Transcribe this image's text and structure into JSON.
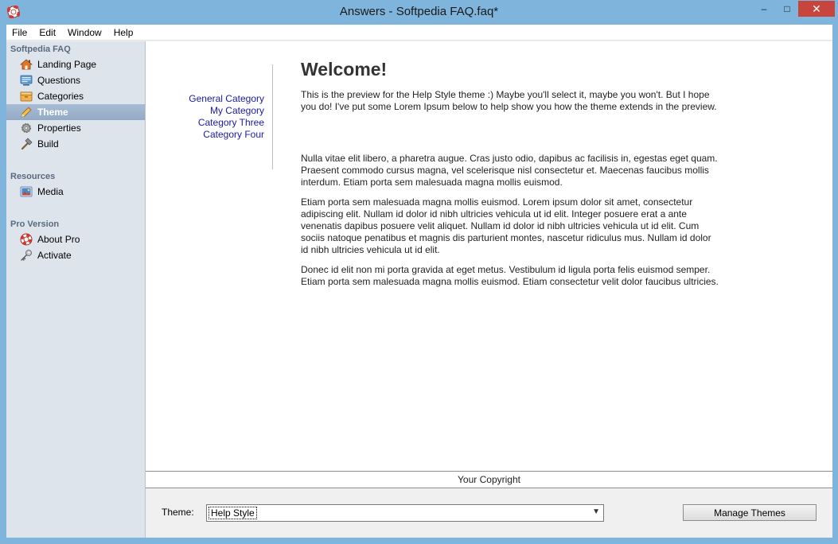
{
  "window": {
    "title": "Answers - Softpedia FAQ.faq*",
    "minimize": "–",
    "maximize": "□",
    "close": "✕"
  },
  "menu": [
    "File",
    "Edit",
    "Window",
    "Help"
  ],
  "sidebar": {
    "sections": [
      {
        "title": "Softpedia FAQ",
        "items": [
          {
            "label": "Landing Page",
            "icon": "house-icon"
          },
          {
            "label": "Questions",
            "icon": "questions-icon"
          },
          {
            "label": "Categories",
            "icon": "categories-icon"
          },
          {
            "label": "Theme",
            "icon": "pencil-icon",
            "selected": true
          },
          {
            "label": "Properties",
            "icon": "gear-icon"
          },
          {
            "label": "Build",
            "icon": "hammer-icon"
          }
        ]
      },
      {
        "title": "Resources",
        "items": [
          {
            "label": "Media",
            "icon": "media-icon"
          }
        ]
      },
      {
        "title": "Pro Version",
        "items": [
          {
            "label": "About Pro",
            "icon": "lifebuoy-icon"
          },
          {
            "label": "Activate",
            "icon": "key-icon"
          }
        ]
      }
    ]
  },
  "preview": {
    "categories": [
      "General Category",
      "My Category",
      "Category Three",
      "Category Four"
    ],
    "heading": "Welcome!",
    "intro": "This is the preview for the Help Style theme :) Maybe you'll select it, maybe you won't. But I hope you do! I've put some Lorem Ipsum below to help show you how the theme extends in the preview.",
    "paragraphs": [
      "Nulla vitae elit libero, a pharetra augue. Cras justo odio, dapibus ac facilisis in, egestas eget quam. Praesent commodo cursus magna, vel scelerisque nisl consectetur et. Maecenas faucibus mollis interdum. Etiam porta sem malesuada magna mollis euismod.",
      "Etiam porta sem malesuada magna mollis euismod. Lorem ipsum dolor sit amet, consectetur adipiscing elit. Nullam id dolor id nibh ultricies vehicula ut id elit. Integer posuere erat a ante venenatis dapibus posuere velit aliquet. Nullam id dolor id nibh ultricies vehicula ut id elit. Cum sociis natoque penatibus et magnis dis parturient montes, nascetur ridiculus mus. Nullam id dolor id nibh ultricies vehicula ut id elit.",
      "Donec id elit non mi porta gravida at eget metus. Vestibulum id ligula porta felis euismod semper. Etiam porta sem malesuada magna mollis euismod. Etiam consectetur velit dolor faucibus ultricies."
    ],
    "copyright": "Your Copyright"
  },
  "bottom": {
    "theme_label": "Theme:",
    "theme_value": "Help Style",
    "manage_label": "Manage Themes"
  },
  "colors": {
    "title_bg": "#7fb4dd",
    "sidebar_bg": "#dee4ec",
    "selected_bg": "#93aac6",
    "link": "#1a1aa6",
    "close_btn": "#c7453d"
  }
}
